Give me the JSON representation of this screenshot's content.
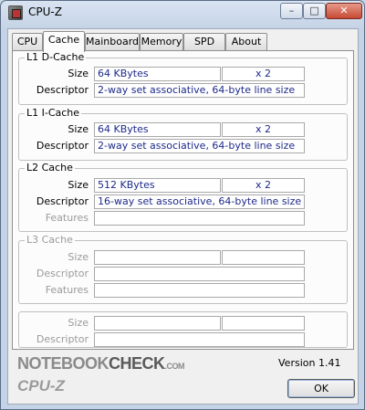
{
  "window": {
    "title": "CPU-Z",
    "min": "–",
    "max": "□",
    "close": "✕"
  },
  "tabs": [
    "CPU",
    "Cache",
    "Mainboard",
    "Memory",
    "SPD",
    "About"
  ],
  "l1d": {
    "title": "L1 D-Cache",
    "size_label": "Size",
    "size": "64 KBytes",
    "count": "x 2",
    "desc_label": "Descriptor",
    "desc": "2-way set associative, 64-byte line size"
  },
  "l1i": {
    "title": "L1 I-Cache",
    "size_label": "Size",
    "size": "64 KBytes",
    "count": "x 2",
    "desc_label": "Descriptor",
    "desc": "2-way set associative, 64-byte line size"
  },
  "l2": {
    "title": "L2 Cache",
    "size_label": "Size",
    "size": "512 KBytes",
    "count": "x 2",
    "desc_label": "Descriptor",
    "desc": "16-way set associative, 64-byte line size",
    "features_label": "Features"
  },
  "l3": {
    "title": "L3 Cache",
    "size_label": "Size",
    "desc_label": "Descriptor",
    "features_label": "Features"
  },
  "extra": {
    "size_label": "Size",
    "desc_label": "Descriptor"
  },
  "watermark": {
    "part1": "NOTEBOOK",
    "part2": "CHECK",
    "part3": ".COM"
  },
  "version": "Version 1.41",
  "footer_logo": "CPU-Z",
  "ok_label": "OK"
}
